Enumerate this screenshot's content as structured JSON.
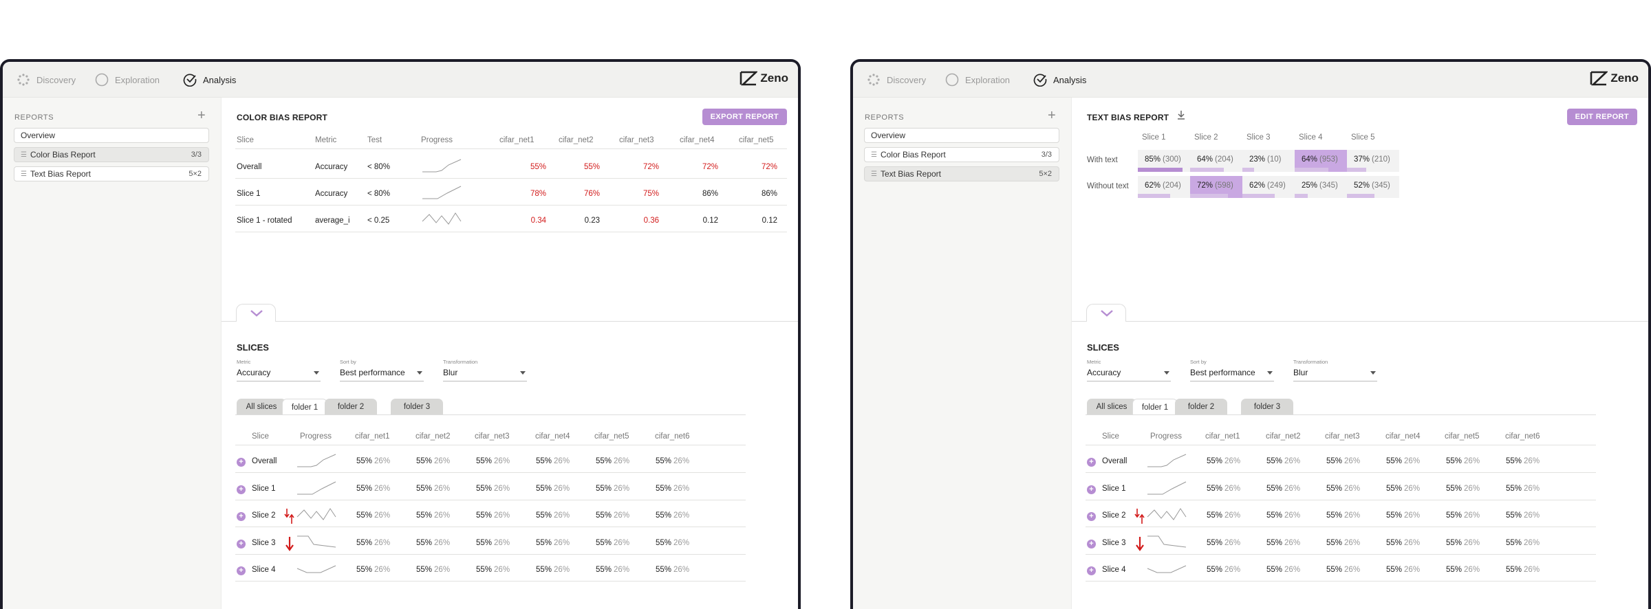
{
  "colors": {
    "accent": "#b68dd2",
    "red": "#d21b1b",
    "frame": "#1c1c28"
  },
  "nav": {
    "steps": [
      {
        "label": "Discovery",
        "icon": "spinner-icon"
      },
      {
        "label": "Exploration",
        "icon": "circle-icon"
      },
      {
        "label": "Analysis",
        "icon": "check-circle-icon"
      }
    ],
    "logo": "Zeno"
  },
  "sidebar": {
    "title": "REPORTS",
    "items": [
      {
        "label": "Overview",
        "count": ""
      },
      {
        "label": "Color Bias Report",
        "count": "3/3"
      },
      {
        "label": "Text Bias Report",
        "count": "5×2"
      }
    ]
  },
  "left": {
    "title": "COLOR BIAS REPORT",
    "button": "EXPORT REPORT",
    "headers": [
      "Slice",
      "Metric",
      "Test",
      "Progress",
      "cifar_net1",
      "cifar_net2",
      "cifar_net3",
      "cifar_net4",
      "cifar_net5"
    ],
    "rows": [
      {
        "slice": "Overall",
        "metric": "Accuracy",
        "test": "< 80%",
        "values": [
          "55%",
          "55%",
          "72%",
          "72%",
          "72%"
        ],
        "fail": [
          true,
          true,
          true,
          true,
          true
        ]
      },
      {
        "slice": "Slice 1",
        "metric": "Accuracy",
        "test": "< 80%",
        "values": [
          "78%",
          "76%",
          "75%",
          "86%",
          "86%"
        ],
        "fail": [
          true,
          true,
          true,
          false,
          false
        ]
      },
      {
        "slice": "Slice 1 - rotated",
        "metric": "average_i",
        "test": "< 0.25",
        "values": [
          "0.34",
          "0.23",
          "0.36",
          "0.12",
          "0.12"
        ],
        "fail": [
          true,
          false,
          true,
          false,
          false
        ]
      }
    ]
  },
  "right": {
    "title": "TEXT BIAS REPORT",
    "button": "EDIT REPORT",
    "columns": [
      "Slice 1",
      "Slice 2",
      "Slice 3",
      "Slice 4",
      "Slice 5"
    ],
    "rows": [
      {
        "label": "With text",
        "cells": [
          {
            "pct": "85%",
            "n": "(300)",
            "value": 0.85
          },
          {
            "pct": "64%",
            "n": "(204)",
            "value": 0.64
          },
          {
            "pct": "23%",
            "n": "(10)",
            "value": 0.23
          },
          {
            "pct": "64%",
            "n": "(953)",
            "value": 0.64,
            "highlight": true
          },
          {
            "pct": "37%",
            "n": "(210)",
            "value": 0.37
          }
        ]
      },
      {
        "label": "Without text",
        "cells": [
          {
            "pct": "62%",
            "n": "(204)",
            "value": 0.62
          },
          {
            "pct": "72%",
            "n": "(598)",
            "value": 0.72,
            "highlight": true
          },
          {
            "pct": "62%",
            "n": "(249)",
            "value": 0.62
          },
          {
            "pct": "25%",
            "n": "(345)",
            "value": 0.25
          },
          {
            "pct": "52%",
            "n": "(345)",
            "value": 0.52
          }
        ]
      }
    ]
  },
  "slices": {
    "title": "SLICES",
    "controls": [
      {
        "label": "Metric",
        "value": "Accuracy"
      },
      {
        "label": "Sort by",
        "value": "Best performance"
      },
      {
        "label": "Transformation",
        "value": "Blur"
      }
    ],
    "tabs": [
      "All slices",
      "folder 1",
      "folder 2",
      "folder 3"
    ],
    "active_tab": "folder 1",
    "headers": [
      "Slice",
      "Progress",
      "cifar_net1",
      "cifar_net2",
      "cifar_net3",
      "cifar_net4",
      "cifar_net5",
      "cifar_net6"
    ],
    "rows": [
      {
        "name": "Overall",
        "indicator": "",
        "main": "55%",
        "sub": "26%"
      },
      {
        "name": "Slice 1",
        "indicator": "",
        "main": "55%",
        "sub": "26%"
      },
      {
        "name": "Slice 2",
        "indicator": "mixed",
        "main": "55%",
        "sub": "26%"
      },
      {
        "name": "Slice 3",
        "indicator": "down",
        "main": "55%",
        "sub": "26%"
      },
      {
        "name": "Slice 4",
        "indicator": "",
        "main": "55%",
        "sub": "26%"
      }
    ]
  }
}
